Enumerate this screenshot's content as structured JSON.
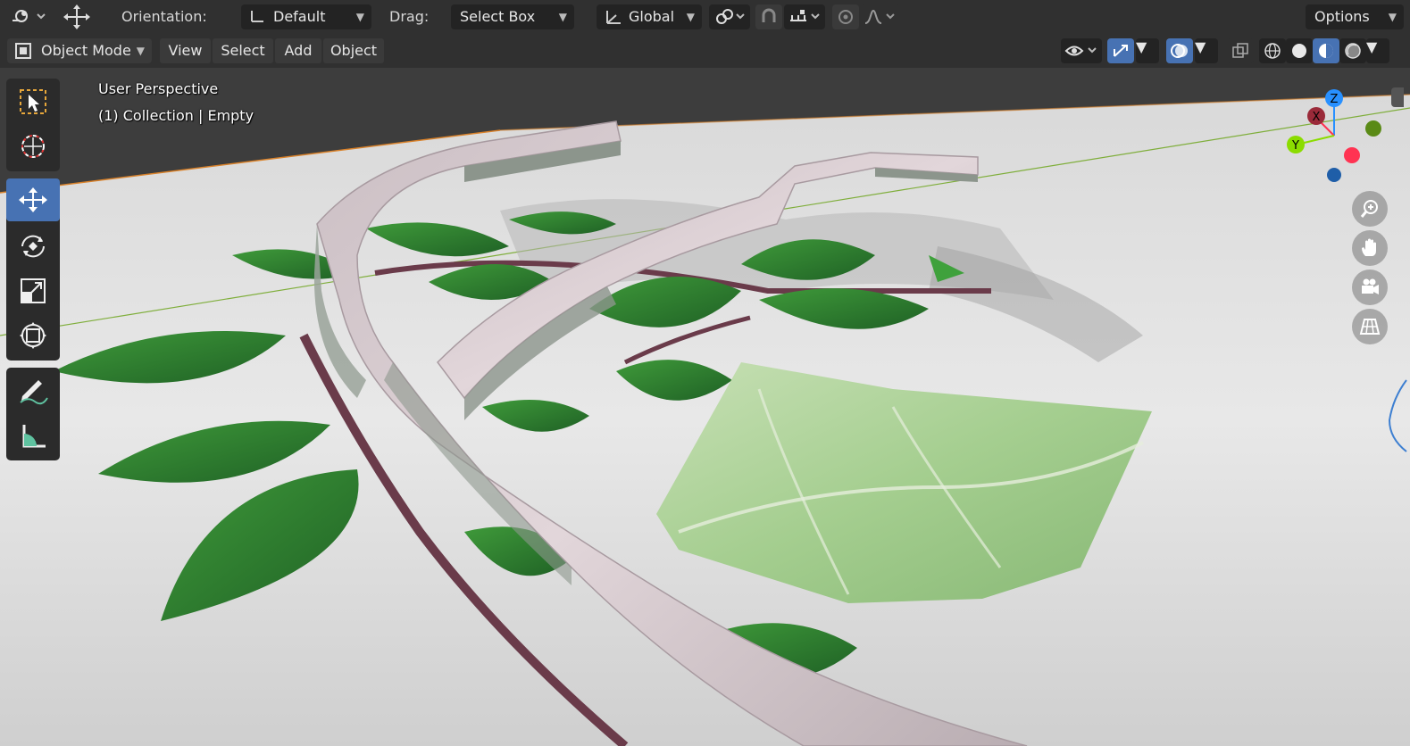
{
  "header": {
    "orientation_label": "Orientation:",
    "orientation_value": "Default",
    "drag_label": "Drag:",
    "drag_value": "Select Box",
    "transform_space": "Global",
    "options_label": "Options"
  },
  "menubar": {
    "mode": "Object Mode",
    "menus": [
      "View",
      "Select",
      "Add",
      "Object"
    ]
  },
  "viewport": {
    "perspective_text": "User Perspective",
    "collection_text": "(1) Collection | Empty"
  },
  "gizmo": {
    "axis_x": "X",
    "axis_y": "Y",
    "axis_z": "Z",
    "color_x": "#ff3352",
    "color_y": "#8bdc00",
    "color_z": "#2890ff"
  },
  "theme": {
    "accent": "#4772b3",
    "header_bg": "#303030",
    "widget_bg": "#232323"
  },
  "toolbar_icons": [
    "select-box-icon",
    "cursor-icon",
    "move-icon",
    "rotate-icon",
    "scale-icon",
    "transform-icon",
    "annotate-icon",
    "measure-icon"
  ],
  "navigation_icons": [
    "zoom-icon",
    "pan-hand-icon",
    "camera-icon",
    "grid-ortho-icon"
  ]
}
